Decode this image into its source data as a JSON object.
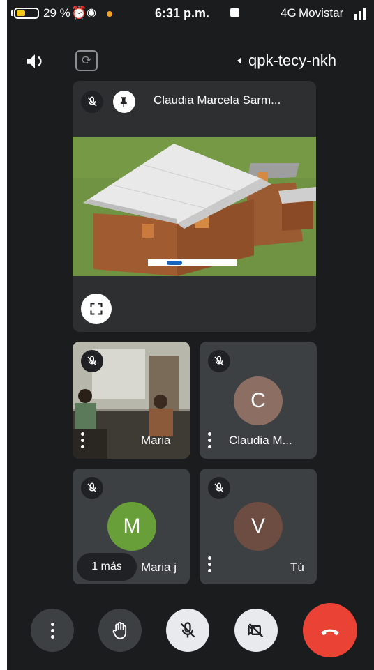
{
  "status_bar": {
    "battery_percent": "29 %",
    "time": "6:31 p.m.",
    "network": "4G",
    "operator": "Movistar"
  },
  "header": {
    "meeting_code": "qpk-tecy-nkh",
    "icons": [
      "speaker-icon",
      "switch-camera-icon",
      "caret-icon"
    ]
  },
  "presentation": {
    "presenter": "Claudia Marcela Sarm...",
    "slide_buttons": [
      "",
      ""
    ],
    "icons": [
      "mic-off-icon",
      "pin-icon",
      "fullscreen-icon"
    ]
  },
  "participants": [
    {
      "label": "Maria",
      "type": "video"
    },
    {
      "label": "Claudia M...",
      "initial": "C",
      "avatar_color": "#8d6e63"
    },
    {
      "label": "Maria j",
      "initial": "M",
      "avatar_color": "#689f38"
    },
    {
      "label": "Tú",
      "initial": "V",
      "avatar_color": "#6d4c41"
    }
  ],
  "more_pill": "1 más",
  "controls": {
    "icons": [
      "more-options-icon",
      "raise-hand-icon",
      "mic-off-icon",
      "camera-off-icon",
      "end-call-icon"
    ],
    "end_call_color": "#ea4335"
  }
}
